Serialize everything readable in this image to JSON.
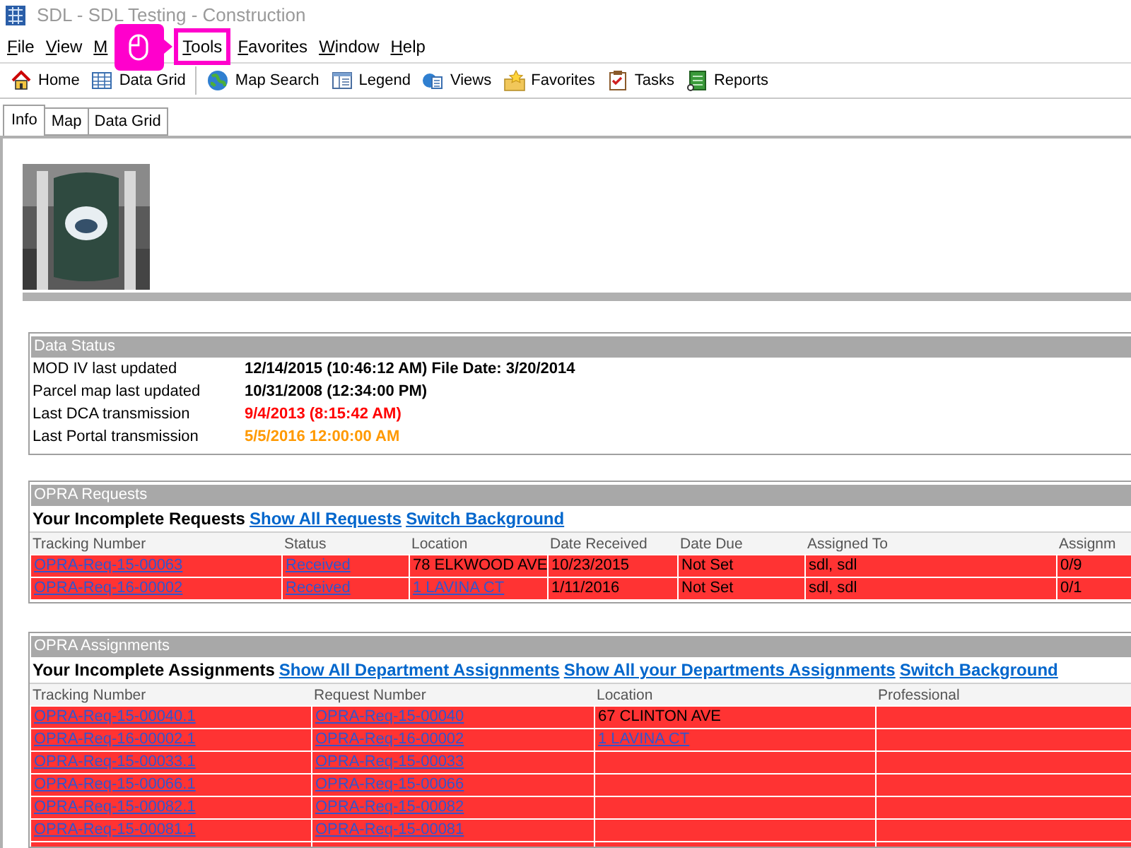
{
  "window": {
    "title": "SDL - SDL Testing - Construction"
  },
  "menu": [
    {
      "label": "File",
      "highlighted": false
    },
    {
      "label": "View",
      "highlighted": false
    },
    {
      "label": "M",
      "highlighted": false
    },
    {
      "label": "Tools",
      "highlighted": true
    },
    {
      "label": "Favorites",
      "highlighted": false
    },
    {
      "label": "Window",
      "highlighted": false
    },
    {
      "label": "Help",
      "highlighted": false
    }
  ],
  "toolbar": [
    {
      "label": "Home",
      "kind": "home"
    },
    {
      "label": "Data Grid",
      "kind": "grid"
    },
    {
      "label": "Map Search",
      "kind": "globe"
    },
    {
      "label": "Legend",
      "kind": "legend"
    },
    {
      "label": "Views",
      "kind": "views"
    },
    {
      "label": "Favorites",
      "kind": "star"
    },
    {
      "label": "Tasks",
      "kind": "tasks"
    },
    {
      "label": "Reports",
      "kind": "reports"
    }
  ],
  "tabs": [
    {
      "label": "Info",
      "selected": true
    },
    {
      "label": "Map",
      "selected": false
    },
    {
      "label": "Data Grid",
      "selected": false
    }
  ],
  "data_status": {
    "title": "Data Status",
    "rows": [
      {
        "label": "MOD IV last updated",
        "value": "12/14/2015 (10:46:12 AM) File Date: 3/20/2014",
        "color": "#000000"
      },
      {
        "label": "Parcel map last updated",
        "value": "10/31/2008 (12:34:00 PM)",
        "color": "#000000"
      },
      {
        "label": "Last DCA transmission",
        "value": "9/4/2013 (8:15:42 AM)",
        "color": "#ff0000"
      },
      {
        "label": "Last Portal transmission",
        "value": "5/5/2016 12:00:00 AM",
        "color": "#ff9900"
      }
    ]
  },
  "opra_requests": {
    "title": "OPRA Requests",
    "heading": "Your Incomplete Requests",
    "links": [
      "Show All Requests",
      "Switch Background"
    ],
    "columns": [
      "Tracking Number",
      "Status",
      "Location",
      "Date Received",
      "Date Due",
      "Assigned To",
      "Assignm"
    ],
    "rows": [
      {
        "color": "#ff3333",
        "cells": [
          {
            "text": "OPRA-Req-15-00063",
            "link": true
          },
          {
            "text": "Received",
            "link": true
          },
          {
            "text": "78 ELKWOOD AVE",
            "link": false
          },
          {
            "text": "10/23/2015",
            "link": false
          },
          {
            "text": "Not Set",
            "link": false
          },
          {
            "text": "sdl, sdl",
            "link": false
          },
          {
            "text": "0/9",
            "link": false
          }
        ]
      },
      {
        "color": "#ff3333",
        "cells": [
          {
            "text": "OPRA-Req-16-00002",
            "link": true
          },
          {
            "text": "Received",
            "link": true
          },
          {
            "text": "1 LAVINA CT",
            "link": true
          },
          {
            "text": "1/11/2016",
            "link": false
          },
          {
            "text": "Not Set",
            "link": false
          },
          {
            "text": "sdl, sdl",
            "link": false
          },
          {
            "text": "0/1",
            "link": false
          }
        ]
      }
    ]
  },
  "opra_assignments": {
    "title": "OPRA Assignments",
    "heading": "Your Incomplete Assignments",
    "links": [
      "Show All Department Assignments",
      "Show All your Departments Assignments",
      "Switch Background"
    ],
    "columns": [
      "Tracking Number",
      "Request Number",
      "Location",
      "Professional"
    ],
    "rows": [
      {
        "color": "#ff3333",
        "cells": [
          {
            "text": "OPRA-Req-15-00040.1",
            "link": true
          },
          {
            "text": "OPRA-Req-15-00040",
            "link": true
          },
          {
            "text": "67 CLINTON AVE",
            "link": false
          }
        ]
      },
      {
        "color": "#ff3333",
        "cells": [
          {
            "text": "OPRA-Req-16-00002.1",
            "link": true
          },
          {
            "text": "OPRA-Req-16-00002",
            "link": true
          },
          {
            "text": "1 LAVINA CT",
            "link": true
          }
        ]
      },
      {
        "color": "#ff3333",
        "cells": [
          {
            "text": "OPRA-Req-15-00033.1",
            "link": true
          },
          {
            "text": "OPRA-Req-15-00033",
            "link": true
          }
        ]
      },
      {
        "color": "#ff3333",
        "cells": [
          {
            "text": "OPRA-Req-15-00066.1",
            "link": true
          },
          {
            "text": "OPRA-Req-15-00066",
            "link": true
          }
        ]
      },
      {
        "color": "#ff3333",
        "cells": [
          {
            "text": "OPRA-Req-15-00082.1",
            "link": true
          },
          {
            "text": "OPRA-Req-15-00082",
            "link": true
          }
        ]
      },
      {
        "color": "#ff3333",
        "cells": [
          {
            "text": "OPRA-Req-15-00081.1",
            "link": true
          },
          {
            "text": "OPRA-Req-15-00081",
            "link": true
          }
        ]
      },
      {
        "color": "#ff3333",
        "cells": []
      }
    ]
  }
}
